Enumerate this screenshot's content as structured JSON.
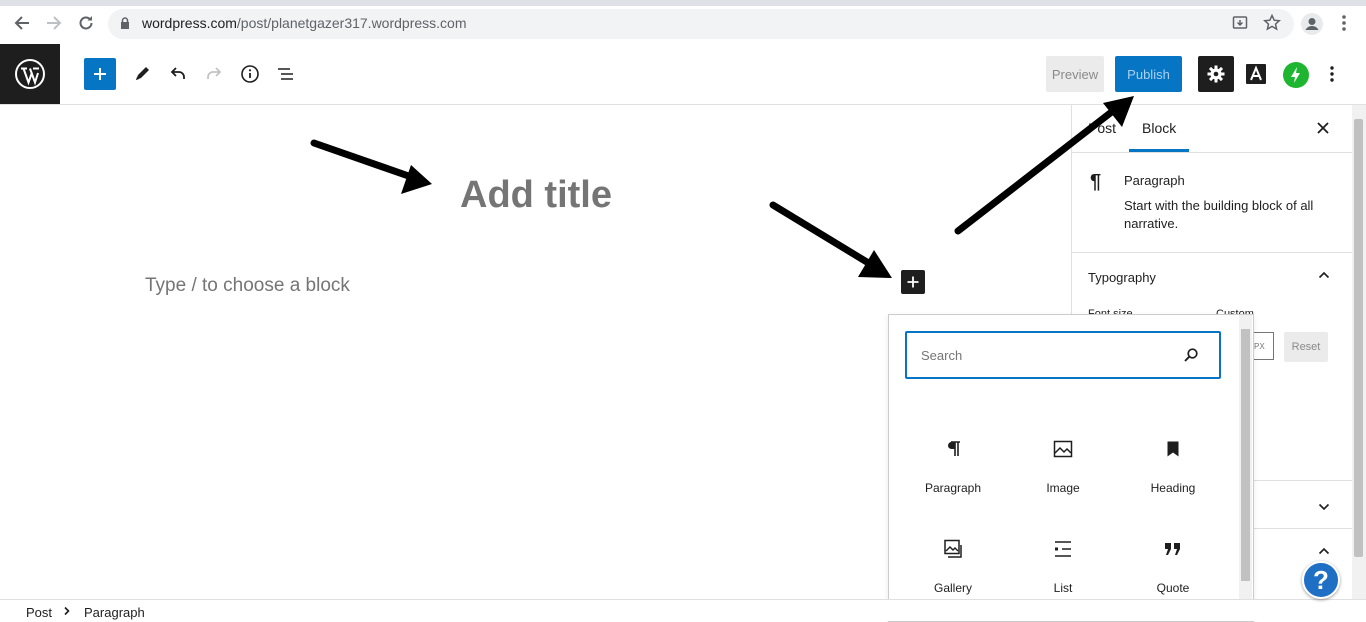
{
  "browser": {
    "url_domain": "wordpress.com",
    "url_path": "/post/planetgazer317.wordpress.com"
  },
  "header": {
    "preview_label": "Preview",
    "publish_label": "Publish",
    "accent_color": "#0675c4"
  },
  "editor": {
    "title_placeholder": "Add title",
    "block_placeholder": "Type / to choose a block"
  },
  "sidebar": {
    "tabs": [
      {
        "label": "Post"
      },
      {
        "label": "Block"
      }
    ],
    "block_card": {
      "title": "Paragraph",
      "description": "Start with the building block of all narrative."
    },
    "typography": {
      "title": "Typography",
      "font_size_label": "Font size",
      "custom_label": "Custom",
      "unit": "PX",
      "reset_label": "Reset"
    }
  },
  "inserter": {
    "search_placeholder": "Search",
    "blocks": [
      {
        "label": "Paragraph",
        "icon": "paragraph-icon"
      },
      {
        "label": "Image",
        "icon": "image-icon"
      },
      {
        "label": "Heading",
        "icon": "heading-icon"
      },
      {
        "label": "Gallery",
        "icon": "gallery-icon"
      },
      {
        "label": "List",
        "icon": "list-icon"
      },
      {
        "label": "Quote",
        "icon": "quote-icon"
      }
    ]
  },
  "footer": {
    "breadcrumbs": [
      "Post",
      "Paragraph"
    ]
  },
  "help": {
    "label": "?"
  }
}
